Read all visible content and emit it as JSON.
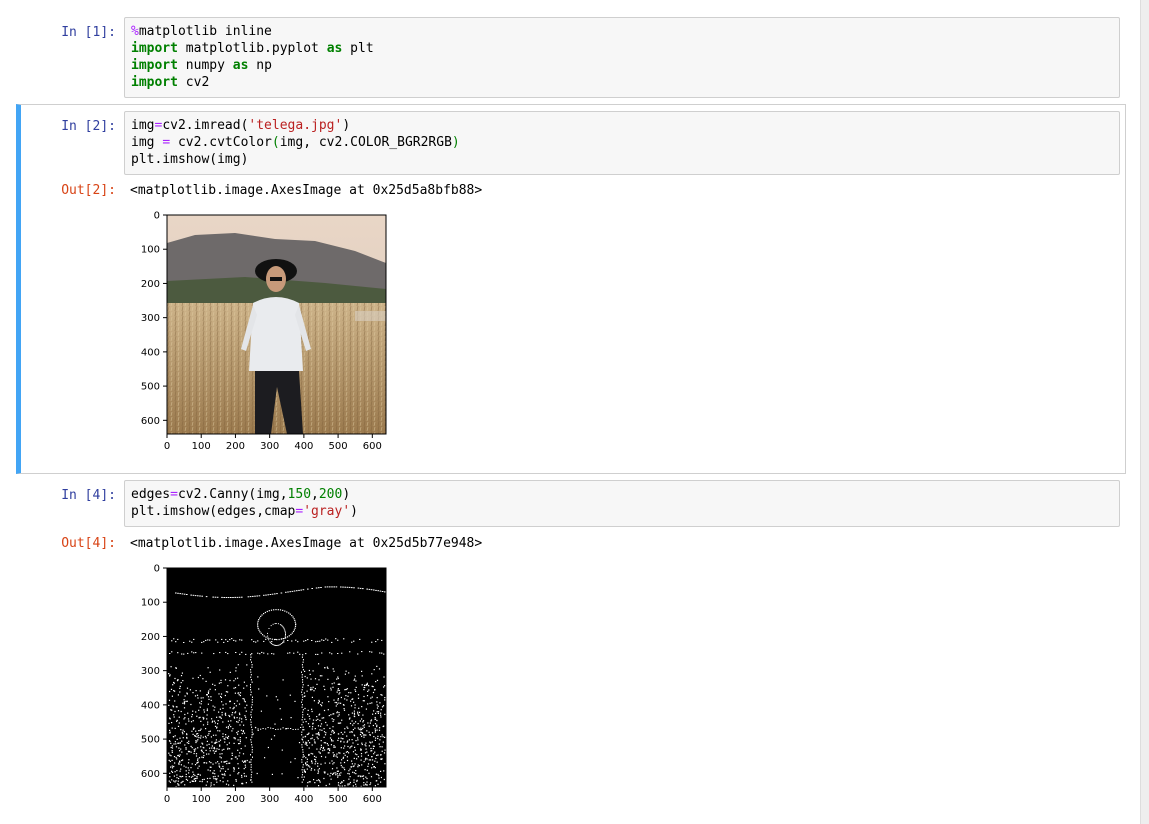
{
  "cells": [
    {
      "prompt": "In [1]:",
      "lines": [
        [
          [
            "magic",
            "%"
          ],
          [
            "t",
            "matplotlib inline"
          ]
        ],
        [
          [
            "kw",
            "import"
          ],
          [
            "t",
            " matplotlib.pyplot "
          ],
          [
            "kw",
            "as"
          ],
          [
            "t",
            " plt"
          ]
        ],
        [
          [
            "kw",
            "import"
          ],
          [
            "t",
            " numpy "
          ],
          [
            "kw",
            "as"
          ],
          [
            "t",
            " np"
          ]
        ],
        [
          [
            "kw",
            "import"
          ],
          [
            "t",
            " cv2"
          ]
        ]
      ]
    },
    {
      "prompt": "In [2]:",
      "lines": [
        [
          [
            "t",
            "img"
          ],
          [
            "op",
            "="
          ],
          [
            "t",
            "cv2.imread("
          ],
          [
            "str",
            "'telega.jpg'"
          ],
          [
            "t",
            ")"
          ]
        ],
        [
          [
            "t",
            "img "
          ],
          [
            "op",
            "="
          ],
          [
            "t",
            " cv2.cvtColor"
          ],
          [
            "num",
            "("
          ],
          [
            "t",
            "img, cv2.COLOR_BGR2RGB"
          ],
          [
            "num",
            ")"
          ]
        ],
        [
          [
            "t",
            "plt.imshow(img)"
          ]
        ]
      ],
      "out_prompt": "Out[2]:",
      "out_text": "<matplotlib.image.AxesImage at 0x25d5a8bfb88>"
    },
    {
      "prompt": "In [4]:",
      "lines": [
        [
          [
            "t",
            "edges"
          ],
          [
            "op",
            "="
          ],
          [
            "t",
            "cv2.Canny(img,"
          ],
          [
            "num",
            "150"
          ],
          [
            "t",
            ","
          ],
          [
            "num",
            "200"
          ],
          [
            "t",
            ")"
          ]
        ],
        [
          [
            "t",
            "plt.imshow(edges,cmap"
          ],
          [
            "op",
            "="
          ],
          [
            "str",
            "'gray'"
          ],
          [
            "t",
            ")"
          ]
        ]
      ],
      "out_prompt": "Out[4]:",
      "out_text": "<matplotlib.image.AxesImage at 0x25d5b77e948>"
    }
  ],
  "plot": {
    "yticks": [
      "0",
      "100",
      "200",
      "300",
      "400",
      "500",
      "600"
    ],
    "xticks": [
      "0",
      "100",
      "200",
      "300",
      "400",
      "500",
      "600"
    ],
    "ytick_values": [
      0,
      100,
      200,
      300,
      400,
      500,
      600
    ],
    "xtick_values": [
      0,
      100,
      200,
      300,
      400,
      500,
      600
    ],
    "extent": 640
  },
  "colors": {
    "in_prompt": "#303f9f",
    "out_prompt": "#d84315",
    "selected_bar": "#42a5f5"
  }
}
